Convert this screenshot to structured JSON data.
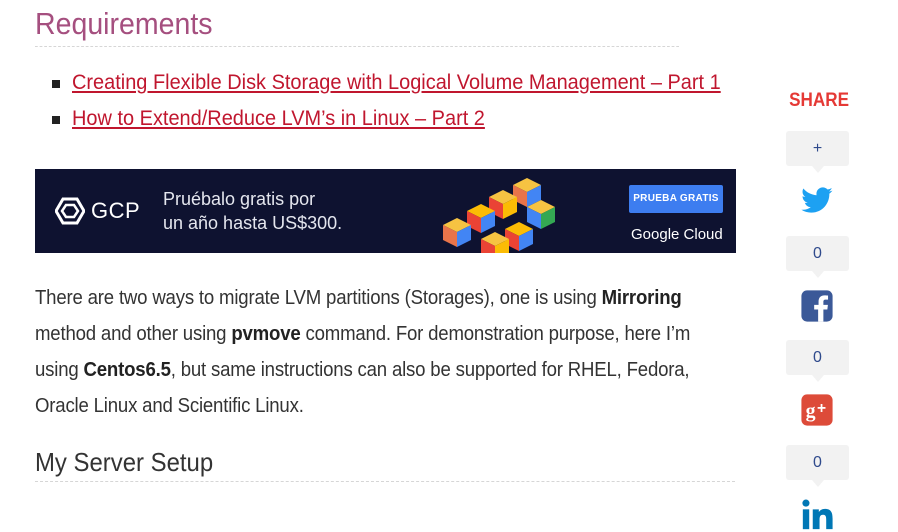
{
  "article": {
    "requirements_heading": "Requirements",
    "links": [
      "Creating Flexible Disk Storage with Logical Volume Management – Part 1",
      "How to Extend/Reduce LVM’s in Linux – Part 2"
    ],
    "paragraph": {
      "l1_a": "There are two ways to migrate LVM partitions (Storages), one is using ",
      "l1_b": "Mirroring",
      "l2_a": "method and other using ",
      "l2_b": "pvmove",
      "l2_c": " command. For demonstration purpose, here I’m",
      "l3_a": "using ",
      "l3_b": "Centos6.5",
      "l3_c": ", but same instructions can also be supported for RHEL, Fedora,",
      "l4": "Oracle Linux and Scientific Linux."
    },
    "section_heading": "My Server Setup"
  },
  "ad": {
    "brand": "GCP",
    "promo_line1": "Pruébalo gratis por",
    "promo_line2": "un año hasta US$300.",
    "cta": "PRUEBA GRATIS",
    "cloud_logo": "Google Cloud"
  },
  "share": {
    "title": "SHARE",
    "counts": [
      "+",
      "0",
      "0",
      "0"
    ],
    "icons": [
      "twitter-icon",
      "facebook-icon",
      "google-plus-icon",
      "linkedin-icon"
    ],
    "colors": {
      "twitter": "#1da1f2",
      "facebook": "#3b5998",
      "google_plus": "#dd4b39",
      "linkedin": "#0077b5",
      "title": "#e53935"
    }
  },
  "colors": {
    "heading": "#a54f7f",
    "link": "#c0162e",
    "banner_bg": "#0e1230",
    "cta_bg": "#3d7df0"
  }
}
